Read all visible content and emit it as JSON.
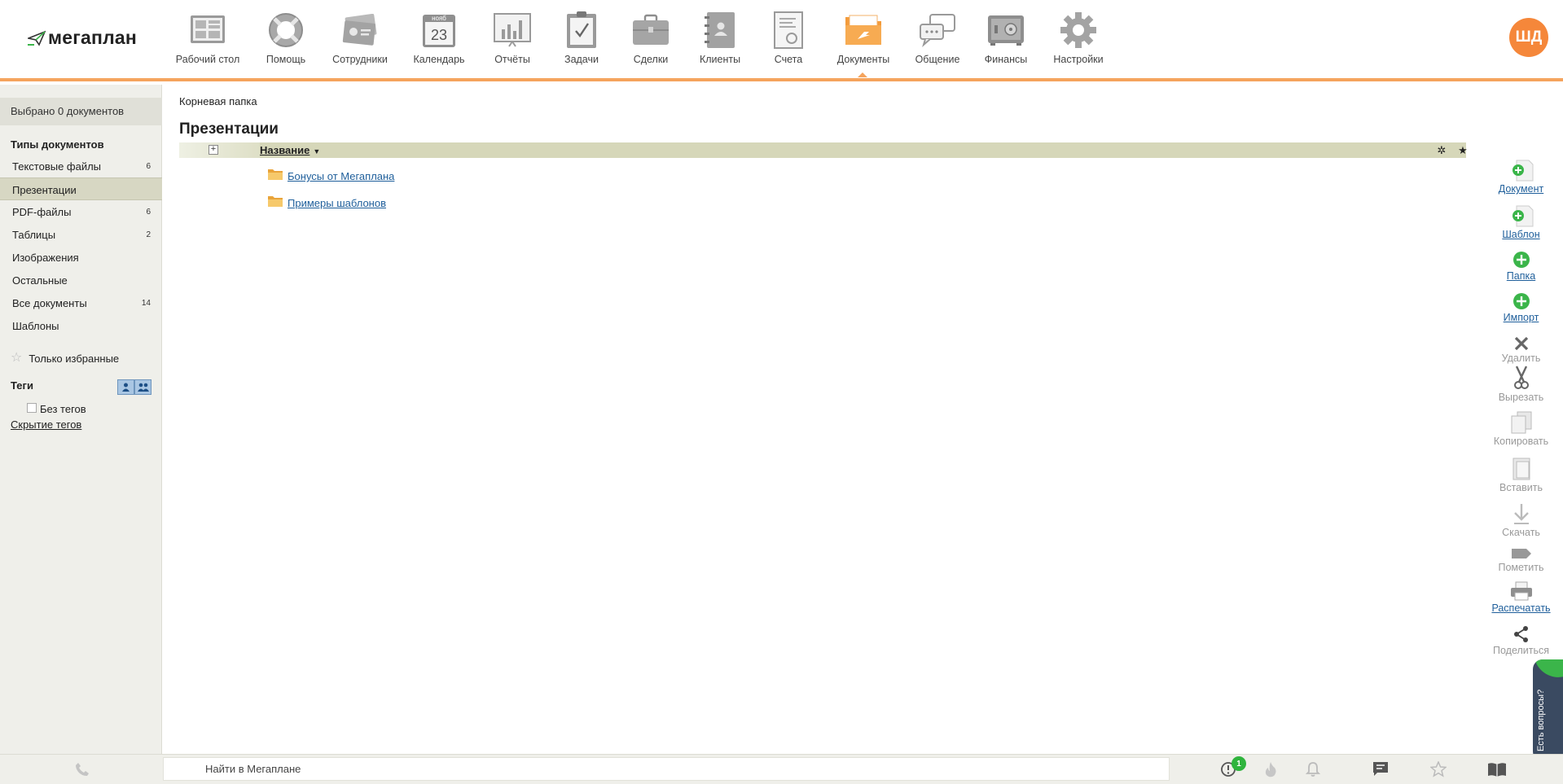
{
  "app": {
    "logo_text": "мегаплан",
    "avatar_initials": "ШД"
  },
  "nav": [
    {
      "label": "Рабочий стол",
      "icon": "desktop-icon"
    },
    {
      "label": "Помощь",
      "icon": "lifebuoy-icon"
    },
    {
      "label": "Сотрудники",
      "icon": "employees-card-icon"
    },
    {
      "label": "Календарь",
      "icon": "calendar-icon",
      "month": "нояб",
      "day": "23"
    },
    {
      "label": "Отчёты",
      "icon": "reports-chart-icon"
    },
    {
      "label": "Задачи",
      "icon": "tasks-clipboard-icon"
    },
    {
      "label": "Сделки",
      "icon": "deals-briefcase-icon"
    },
    {
      "label": "Клиенты",
      "icon": "clients-notebook-icon"
    },
    {
      "label": "Счета",
      "icon": "invoice-icon"
    },
    {
      "label": "Документы",
      "icon": "documents-folder-icon",
      "active": true
    },
    {
      "label": "Общение",
      "icon": "chat-bubbles-icon"
    },
    {
      "label": "Финансы",
      "icon": "safe-icon"
    },
    {
      "label": "Настройки",
      "icon": "settings-gear-icon"
    }
  ],
  "sidebar": {
    "selected_count": "Выбрано 0 документов",
    "types_heading": "Типы документов",
    "types": [
      {
        "label": "Текстовые файлы",
        "count": "6"
      },
      {
        "label": "Презентации",
        "count": "",
        "active": true
      },
      {
        "label": "PDF-файлы",
        "count": "6"
      },
      {
        "label": "Таблицы",
        "count": "2"
      },
      {
        "label": "Изображения",
        "count": ""
      },
      {
        "label": "Остальные",
        "count": ""
      },
      {
        "label": "Все документы",
        "count": "14"
      },
      {
        "label": "Шаблоны",
        "count": ""
      }
    ],
    "favorites_only": "Только избранные",
    "tags_heading": "Теги",
    "no_tags": "Без тегов",
    "hide_tags": "Скрытие тегов"
  },
  "main": {
    "breadcrumb": "Корневая папка",
    "title": "Презентации",
    "column_name": "Название",
    "rows": [
      {
        "name": "Бонусы от Мегаплана",
        "icon": "folder-icon"
      },
      {
        "name": "Примеры шаблонов",
        "icon": "folder-icon"
      }
    ]
  },
  "actions": {
    "document": "Документ",
    "template": "Шаблон",
    "folder": "Папка",
    "import": "Импорт",
    "delete": "Удалить",
    "cut": "Вырезать",
    "copy": "Копировать",
    "paste": "Вставить",
    "download": "Скачать",
    "mark": "Пометить",
    "print": "Распечатать",
    "share": "Поделиться"
  },
  "help_tab": "Есть вопросы?",
  "footer": {
    "search_placeholder": "Найти в Мегаплане",
    "notification_count": "1"
  },
  "colors": {
    "accent": "#f5a45d",
    "avatar": "#f5873a",
    "link": "#1f5f9b",
    "add_green": "#3bb54a"
  }
}
